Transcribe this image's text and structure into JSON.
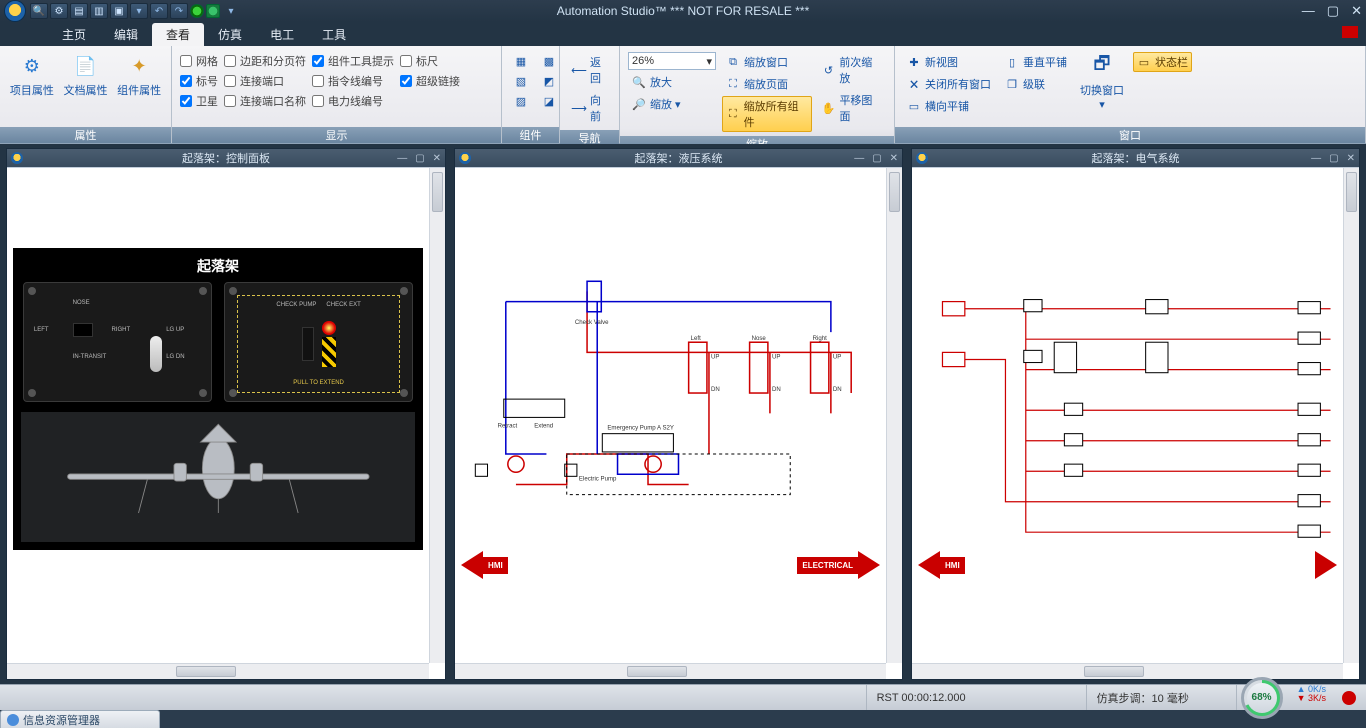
{
  "titlebar": {
    "title": "Automation Studio™    *** NOT FOR RESALE ***"
  },
  "tabs": {
    "items": [
      "主页",
      "编辑",
      "查看",
      "仿真",
      "电工",
      "工具"
    ],
    "active": 2
  },
  "ribbon": {
    "group_attr": {
      "label": "属性",
      "btns": [
        "项目属性",
        "文档属性",
        "组件属性"
      ]
    },
    "group_display": {
      "label": "显示",
      "col1": [
        {
          "t": "网格",
          "c": false
        },
        {
          "t": "标号",
          "c": true
        },
        {
          "t": "卫星",
          "c": true
        }
      ],
      "col2": [
        {
          "t": "边距和分页符",
          "c": false
        },
        {
          "t": "连接端口",
          "c": false
        },
        {
          "t": "连接端口名称",
          "c": false
        }
      ],
      "col3": [
        {
          "t": "组件工具提示",
          "c": true
        },
        {
          "t": "指令线编号",
          "c": false
        },
        {
          "t": "电力线编号",
          "c": false
        }
      ],
      "col4": [
        {
          "t": "标尺",
          "c": false
        },
        {
          "t": "超级链接",
          "c": true
        }
      ]
    },
    "group_comp": {
      "label": "组件"
    },
    "group_nav": {
      "label": "导航",
      "back": "返回",
      "fwd": "向前"
    },
    "group_zoom": {
      "label": "缩放",
      "value": "26%",
      "btns": {
        "win": "缩放窗口",
        "page": "缩放页面",
        "all": "缩放所有组件",
        "in": "放大",
        "out": "缩放 ▾",
        "prev": "前次缩放",
        "pan": "平移图面"
      }
    },
    "group_window": {
      "label": "窗口",
      "btns": {
        "new": "新视图",
        "closeall": "关闭所有窗口",
        "htile": "横向平铺",
        "vtile": "垂直平铺",
        "cascade": "级联",
        "switch": "切换窗口 ▾",
        "status": "状态栏"
      }
    }
  },
  "panes": {
    "p1": {
      "title": "起落架：控制面板",
      "ctrl_title": "起落架",
      "l": {
        "nose": "NOSE",
        "left": "LEFT",
        "right": "RIGHT",
        "intransit": "IN-TRANSIT",
        "lgup": "LG UP",
        "lgdn": "LG DN"
      },
      "r": {
        "chk_pump": "CHECK PUMP",
        "chk_ext": "CHECK EXT",
        "pull": "PULL TO EXTEND"
      }
    },
    "p2": {
      "title": "起落架：液压系统",
      "hmi": "HMI",
      "elec": "ELECTRICAL",
      "lbl": {
        "check": "Check Valve",
        "left": "Left",
        "nose": "Nose",
        "right": "Right",
        "up": "UP",
        "dn": "DN",
        "retract": "Retract",
        "extend": "Extend",
        "epump2": "Emergency Pump A S2Y",
        "epump": "Electric Pump"
      }
    },
    "p3": {
      "title": "起落架：电气系统",
      "hmi": "HMI"
    }
  },
  "status": {
    "rst": "RST 00:00:12.000",
    "step": "仿真步调：10 毫秒",
    "gauge": "68%",
    "r1": "0K/s",
    "r2": "3K/s"
  },
  "footer": "信息资源管理器"
}
